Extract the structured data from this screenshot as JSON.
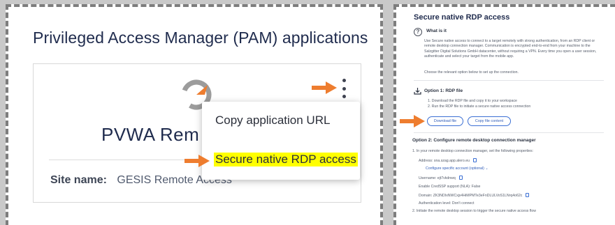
{
  "left_panel": {
    "title": "Privileged Access Manager (PAM) applications",
    "app_card": {
      "name": "PVWA Rem",
      "site_label": "Site name:",
      "site_value": "GESIS Remote Access"
    },
    "context_menu": {
      "items": [
        {
          "label": "Copy application URL"
        },
        {
          "label": "Secure native RDP access",
          "highlighted": true
        }
      ]
    },
    "icons": [
      "kebab-menu-icon",
      "app-logo-icon",
      "arrow-icon"
    ],
    "colors": {
      "arrow": "#ee7d2f",
      "highlight": "#ffff00",
      "title": "#1f2b4d"
    }
  },
  "right_panel": {
    "title": "Secure native RDP access",
    "what_is_it": {
      "label": "What is it",
      "text": "Use Secure native access to connect to a target remotely with strong authentication, from an RDP client or remote desktop connection manager. Communication is encrypted end-to-end from your machine to the Salzgitter Digital Solutions GmbH datacenter, without requiring a VPN. Every time you open a user session, authenticate and select your target from the mobile app.",
      "choose": "Choose the relevant option below to set up the connection."
    },
    "option1": {
      "title": "Option 1: RDP file",
      "steps": [
        "1. Download the RDP file and copy it to your workspace",
        "2. Run the RDP file to initiate a secure native access connection"
      ],
      "download_button": "Download file",
      "copy_button": "Copy file content"
    },
    "option2": {
      "title": "Option 2: Configure remote desktop connection manager",
      "step1": "1. In your remote desktop connection manager, set the following properties:",
      "properties": {
        "address": "Address: sna.szag.app.alero.eu",
        "configure_link": "Configure specific account (optional)",
        "username": "Username: ejt7vkdnwq",
        "credssp": "Enable CredSSP support (NLA): False",
        "domain": "Domain: ZK3NDIxNWCxjx4HiMPMTe3eFnDLULVoS1LNrq4o62c",
        "auth_level": "Authentication level: Don't connect"
      },
      "step2": "2. Initiate the remote desktop session to trigger the secure native access flow"
    },
    "colors": {
      "link": "#2f5cb8",
      "button_border": "#3b6fd4"
    }
  }
}
